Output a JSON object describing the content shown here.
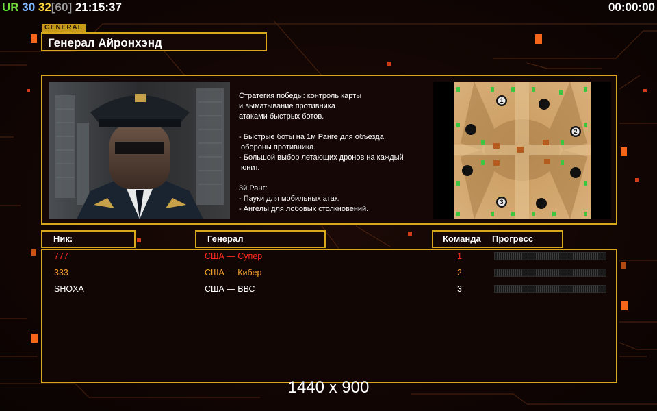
{
  "hud": {
    "ur": "UR",
    "stat1": "30",
    "stat2": "32",
    "stat3": "[60]",
    "clock": "21:15:37",
    "timer": "00:00:00"
  },
  "general": {
    "tag": "GENERAL",
    "name": "Генерал Айронхэнд",
    "description": "Стратегия победы: контроль карты\nи выматывание противника\nатаками быстрых ботов.\n\n- Быстрые боты на 1м Ранге для объезда\n обороны противника.\n- Большой выбор летающих дронов на каждый\n юнит.\n\n3й Ранг:\n- Пауки для мобильных атак.\n- Ангелы для лобовых столкновений."
  },
  "map": {
    "start_labels": [
      "1",
      "2",
      "3"
    ]
  },
  "table": {
    "col_nick": "Ник:",
    "col_general": "Генерал",
    "col_team": "Команда",
    "col_progress": "Прогресс",
    "rows": [
      {
        "nick": "777",
        "general": "США — Супер",
        "team": "1",
        "progress": 0.0,
        "color": "#ff2a1f"
      },
      {
        "nick": "333",
        "general": "США — Кибер",
        "team": "2",
        "progress": 0.0,
        "color": "#f2a12c"
      },
      {
        "nick": "SHOXA",
        "general": "США — ВВС",
        "team": "3",
        "progress": 0.0,
        "color": "#ffffff"
      }
    ]
  },
  "resolution_label": "1440 x 900",
  "colors": {
    "accent_gold": "#d8a71c",
    "background": "#120604"
  }
}
